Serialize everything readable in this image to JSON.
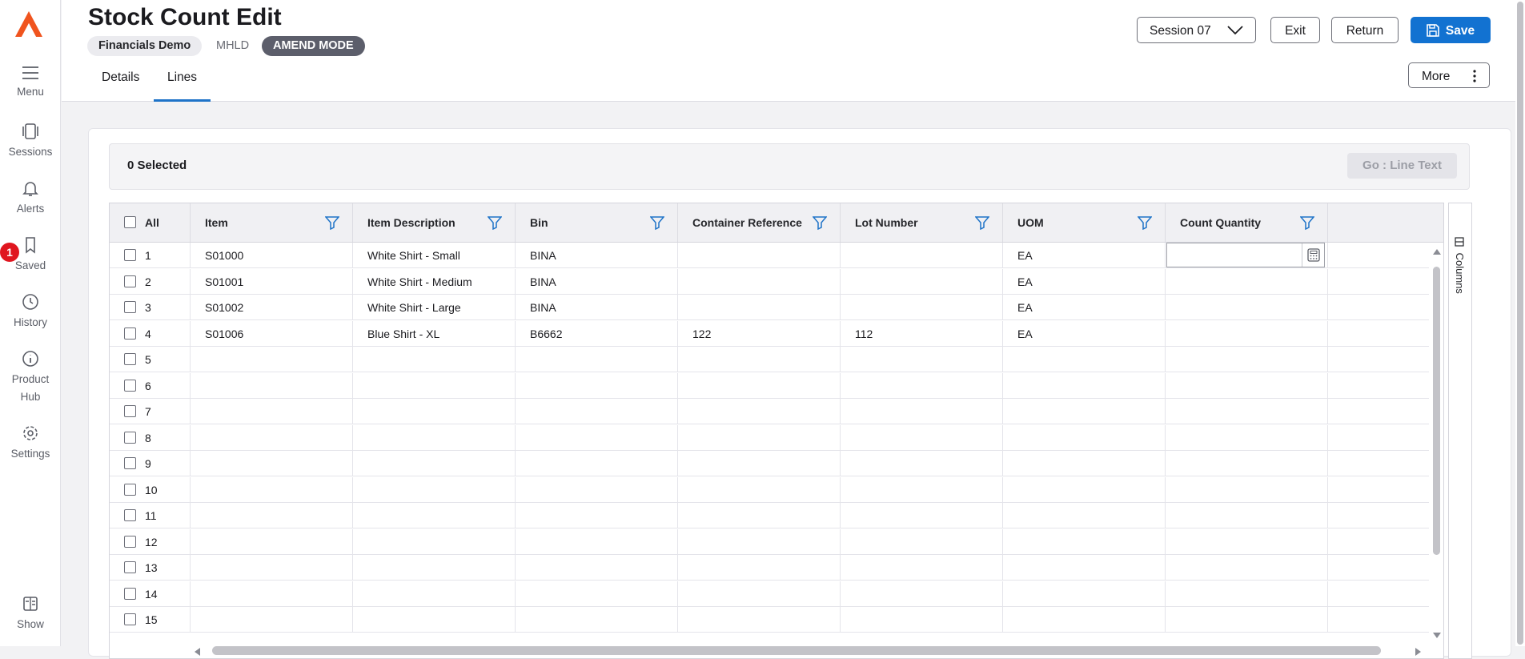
{
  "nav": {
    "items": [
      {
        "label": "Menu",
        "icon": "menu-icon"
      },
      {
        "label": "Sessions",
        "icon": "sessions-icon"
      },
      {
        "label": "Alerts",
        "icon": "bell-icon"
      },
      {
        "label": "Saved",
        "icon": "bookmark-icon"
      },
      {
        "label": "History",
        "icon": "clock-icon"
      },
      {
        "label": "Product",
        "label2": "Hub",
        "icon": "info-icon"
      },
      {
        "label": "Settings",
        "icon": "gear-icon"
      },
      {
        "label": "Show",
        "icon": "show-panel-icon"
      }
    ],
    "saved_badge": "1"
  },
  "header": {
    "title": "Stock Count Edit",
    "company": "Financials Demo",
    "code": "MHLD",
    "mode": "AMEND MODE",
    "tabs": [
      "Details",
      "Lines"
    ],
    "active_tab": "Lines",
    "session_label": "Session 07",
    "exit_label": "Exit",
    "return_label": "Return",
    "save_label": "Save",
    "more_label": "More"
  },
  "selection": {
    "count_text": "0 Selected",
    "go_label": "Go  :  Line Text"
  },
  "grid": {
    "all_label": "All",
    "columns": [
      "Item",
      "Item Description",
      "Bin",
      "Container Reference",
      "Lot Number",
      "UOM",
      "Count Quantity"
    ],
    "rows": [
      {
        "n": "1",
        "item": "S01000",
        "desc": "White Shirt - Small",
        "bin": "BINA",
        "container": "",
        "lot": "",
        "uom": "EA",
        "qty": ""
      },
      {
        "n": "2",
        "item": "S01001",
        "desc": "White Shirt - Medium",
        "bin": "BINA",
        "container": "",
        "lot": "",
        "uom": "EA",
        "qty": ""
      },
      {
        "n": "3",
        "item": "S01002",
        "desc": "White Shirt - Large",
        "bin": "BINA",
        "container": "",
        "lot": "",
        "uom": "EA",
        "qty": ""
      },
      {
        "n": "4",
        "item": "S01006",
        "desc": "Blue Shirt - XL",
        "bin": "B6662",
        "container": "122",
        "lot": "112",
        "uom": "EA",
        "qty": ""
      },
      {
        "n": "5",
        "item": "",
        "desc": "",
        "bin": "",
        "container": "",
        "lot": "",
        "uom": "",
        "qty": ""
      },
      {
        "n": "6",
        "item": "",
        "desc": "",
        "bin": "",
        "container": "",
        "lot": "",
        "uom": "",
        "qty": ""
      },
      {
        "n": "7",
        "item": "",
        "desc": "",
        "bin": "",
        "container": "",
        "lot": "",
        "uom": "",
        "qty": ""
      },
      {
        "n": "8",
        "item": "",
        "desc": "",
        "bin": "",
        "container": "",
        "lot": "",
        "uom": "",
        "qty": ""
      },
      {
        "n": "9",
        "item": "",
        "desc": "",
        "bin": "",
        "container": "",
        "lot": "",
        "uom": "",
        "qty": ""
      },
      {
        "n": "10",
        "item": "",
        "desc": "",
        "bin": "",
        "container": "",
        "lot": "",
        "uom": "",
        "qty": ""
      },
      {
        "n": "11",
        "item": "",
        "desc": "",
        "bin": "",
        "container": "",
        "lot": "",
        "uom": "",
        "qty": ""
      },
      {
        "n": "12",
        "item": "",
        "desc": "",
        "bin": "",
        "container": "",
        "lot": "",
        "uom": "",
        "qty": ""
      },
      {
        "n": "13",
        "item": "",
        "desc": "",
        "bin": "",
        "container": "",
        "lot": "",
        "uom": "",
        "qty": ""
      },
      {
        "n": "14",
        "item": "",
        "desc": "",
        "bin": "",
        "container": "",
        "lot": "",
        "uom": "",
        "qty": ""
      },
      {
        "n": "15",
        "item": "",
        "desc": "",
        "bin": "",
        "container": "",
        "lot": "",
        "uom": "",
        "qty": ""
      }
    ],
    "columns_panel_label": "Columns"
  },
  "colors": {
    "accent": "#1272d1",
    "logo": "#f0541e",
    "badge": "#e0161f",
    "mode_chip": "#5c5e6b"
  }
}
